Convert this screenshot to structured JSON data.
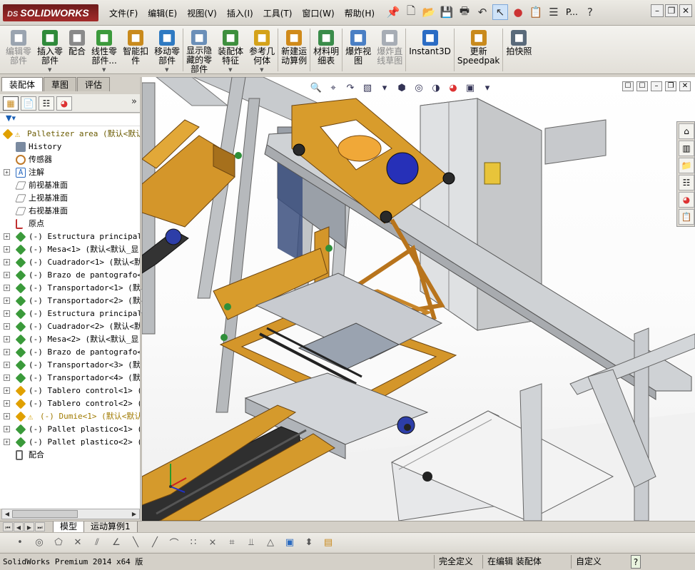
{
  "app": {
    "logo_ds": "DS",
    "logo_text": "SOLIDWORKS"
  },
  "menu": [
    "文件(F)",
    "编辑(E)",
    "视图(V)",
    "插入(I)",
    "工具(T)",
    "窗口(W)",
    "帮助(H)"
  ],
  "quick_access": {
    "options_label": "P..."
  },
  "command_manager": [
    {
      "label": "编辑零\n部件",
      "disabled": true,
      "dropdown": false,
      "color": "#9aa4b0",
      "icon": "edit-component-icon"
    },
    {
      "label": "插入零\n部件",
      "disabled": false,
      "dropdown": true,
      "color": "#2f8a3a",
      "icon": "insert-component-icon"
    },
    {
      "label": "配合",
      "disabled": false,
      "dropdown": false,
      "color": "#8a8a8a",
      "icon": "mate-icon"
    },
    {
      "label": "线性零\n部件...",
      "disabled": false,
      "dropdown": true,
      "color": "#3c9a3c",
      "icon": "linear-pattern-icon"
    },
    {
      "label": "智能扣\n件",
      "disabled": false,
      "dropdown": false,
      "color": "#c98a1d",
      "icon": "smart-fasteners-icon"
    },
    {
      "label": "移动零\n部件",
      "disabled": false,
      "dropdown": true,
      "color": "#2f7ac2",
      "icon": "move-component-icon"
    },
    {
      "label": "显示隐\n藏的零\n部件",
      "disabled": false,
      "dropdown": false,
      "color": "#6b8fb8",
      "icon": "show-hidden-icon"
    },
    {
      "label": "装配体\n特征",
      "disabled": false,
      "dropdown": true,
      "color": "#3e8f3e",
      "icon": "assembly-features-icon"
    },
    {
      "label": "参考几\n何体",
      "disabled": false,
      "dropdown": true,
      "color": "#d4a21a",
      "icon": "reference-geometry-icon"
    },
    {
      "label": "新建运\n动算例",
      "disabled": false,
      "dropdown": false,
      "color": "#d08a1a",
      "icon": "new-motion-study-icon"
    },
    {
      "label": "材料明\n细表",
      "disabled": false,
      "dropdown": false,
      "color": "#3a8c4a",
      "icon": "bill-of-materials-icon"
    },
    {
      "label": "爆炸视\n图",
      "disabled": false,
      "dropdown": false,
      "color": "#4a7fc4",
      "icon": "exploded-view-icon"
    },
    {
      "label": "爆炸直\n线草图",
      "disabled": true,
      "dropdown": false,
      "color": "#a7adb5",
      "icon": "explode-line-sketch-icon"
    },
    {
      "label": "Instant3D",
      "disabled": false,
      "dropdown": false,
      "color": "#2b6cc4",
      "icon": "instant3d-icon"
    },
    {
      "label": "更新\nSpeedpak",
      "disabled": false,
      "dropdown": false,
      "color": "#c98a1d",
      "icon": "update-speedpak-icon"
    },
    {
      "label": "拍快照",
      "disabled": false,
      "dropdown": false,
      "color": "#5a6a7a",
      "icon": "snapshot-icon"
    }
  ],
  "left_tabs": [
    "装配体",
    "草图",
    "评估"
  ],
  "tree": [
    {
      "label": "Palletizer area  (默认<默认",
      "kind": "root",
      "indent": 0,
      "expandable": false,
      "color": "#e0a000"
    },
    {
      "label": "History",
      "kind": "history",
      "indent": 1,
      "expandable": false,
      "color": "#7a8aa0"
    },
    {
      "label": "传感器",
      "kind": "sensor",
      "indent": 1,
      "expandable": false,
      "color": "#c07a2a"
    },
    {
      "label": "注解",
      "kind": "annotation",
      "indent": 1,
      "expandable": true,
      "color": "#2a6ac0"
    },
    {
      "label": "前视基准面",
      "kind": "plane",
      "indent": 1,
      "expandable": false,
      "color": "#888"
    },
    {
      "label": "上视基准面",
      "kind": "plane",
      "indent": 1,
      "expandable": false,
      "color": "#888"
    },
    {
      "label": "右视基准面",
      "kind": "plane",
      "indent": 1,
      "expandable": false,
      "color": "#888"
    },
    {
      "label": "原点",
      "kind": "origin",
      "indent": 1,
      "expandable": false,
      "color": "#c03030"
    },
    {
      "label": "(-) Estructura principal<",
      "kind": "asm",
      "indent": 1,
      "expandable": true,
      "color": "#3a9a3a"
    },
    {
      "label": "(-) Mesa<1> (默认<默认_显",
      "kind": "asm",
      "indent": 1,
      "expandable": true,
      "color": "#3a9a3a"
    },
    {
      "label": "(-) Cuadrador<1> (默认<默",
      "kind": "asm",
      "indent": 1,
      "expandable": true,
      "color": "#3a9a3a"
    },
    {
      "label": "(-) Brazo de pantografo<1",
      "kind": "asm",
      "indent": 1,
      "expandable": true,
      "color": "#3a9a3a"
    },
    {
      "label": "(-) Transportador<1> (默认",
      "kind": "asm",
      "indent": 1,
      "expandable": true,
      "color": "#3a9a3a"
    },
    {
      "label": "(-) Transportador<2> (默认",
      "kind": "asm",
      "indent": 1,
      "expandable": true,
      "color": "#3a9a3a"
    },
    {
      "label": "(-) Estructura principal<",
      "kind": "asm",
      "indent": 1,
      "expandable": true,
      "color": "#3a9a3a"
    },
    {
      "label": "(-) Cuadrador<2> (默认<默",
      "kind": "asm",
      "indent": 1,
      "expandable": true,
      "color": "#3a9a3a"
    },
    {
      "label": "(-) Mesa<2> (默认<默认_显",
      "kind": "asm",
      "indent": 1,
      "expandable": true,
      "color": "#3a9a3a"
    },
    {
      "label": "(-) Brazo de pantografo<2",
      "kind": "asm",
      "indent": 1,
      "expandable": true,
      "color": "#3a9a3a"
    },
    {
      "label": "(-) Transportador<3> (默认",
      "kind": "asm",
      "indent": 1,
      "expandable": true,
      "color": "#3a9a3a"
    },
    {
      "label": "(-) Transportador<4> (默认",
      "kind": "asm",
      "indent": 1,
      "expandable": true,
      "color": "#3a9a3a"
    },
    {
      "label": "(-) Tablero control<1> (默",
      "kind": "part",
      "indent": 1,
      "expandable": true,
      "color": "#e0a000"
    },
    {
      "label": "(-) Tablero control<2> (默",
      "kind": "part",
      "indent": 1,
      "expandable": true,
      "color": "#e0a000"
    },
    {
      "label": "(-) Dumie<1> (默认<默认",
      "kind": "warn",
      "indent": 1,
      "expandable": true,
      "color": "#e0a000"
    },
    {
      "label": "(-) Pallet plastico<1> (默",
      "kind": "asm",
      "indent": 1,
      "expandable": true,
      "color": "#3a9a3a"
    },
    {
      "label": "(-) Pallet plastico<2> (默",
      "kind": "asm",
      "indent": 1,
      "expandable": true,
      "color": "#3a9a3a"
    },
    {
      "label": "配合",
      "kind": "mates",
      "indent": 1,
      "expandable": false,
      "color": "#666"
    }
  ],
  "bottom_tabs": [
    "模型",
    "运动算例1"
  ],
  "status": {
    "version": "SolidWorks Premium 2014 x64 版",
    "defined": "完全定义",
    "editing": "在编辑 装配体",
    "custom": "自定义"
  }
}
